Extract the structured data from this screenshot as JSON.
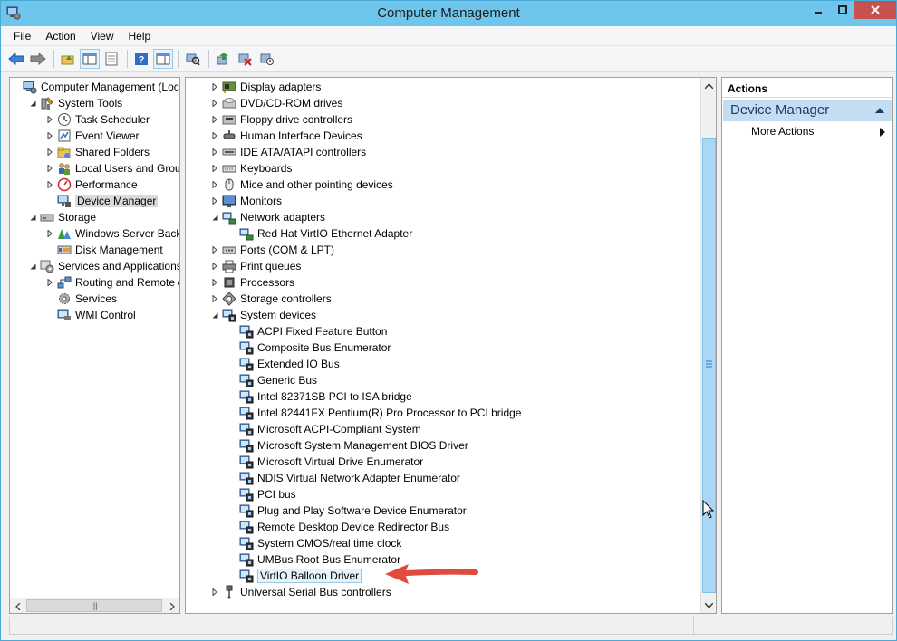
{
  "window": {
    "title": "Computer Management"
  },
  "menu": [
    "File",
    "Action",
    "View",
    "Help"
  ],
  "left_tree": [
    {
      "label": "Computer Management (Local",
      "level": 0,
      "expander": "none",
      "icon": "computer-management-icon"
    },
    {
      "label": "System Tools",
      "level": 1,
      "expander": "expanded",
      "icon": "system-tools-icon"
    },
    {
      "label": "Task Scheduler",
      "level": 2,
      "expander": "collapsed",
      "icon": "clock-icon"
    },
    {
      "label": "Event Viewer",
      "level": 2,
      "expander": "collapsed",
      "icon": "event-viewer-icon"
    },
    {
      "label": "Shared Folders",
      "level": 2,
      "expander": "collapsed",
      "icon": "shared-folder-icon"
    },
    {
      "label": "Local Users and Groups",
      "level": 2,
      "expander": "collapsed",
      "icon": "users-icon"
    },
    {
      "label": "Performance",
      "level": 2,
      "expander": "collapsed",
      "icon": "performance-icon"
    },
    {
      "label": "Device Manager",
      "level": 2,
      "expander": "none",
      "icon": "device-manager-icon",
      "selected": true
    },
    {
      "label": "Storage",
      "level": 1,
      "expander": "expanded",
      "icon": "storage-icon"
    },
    {
      "label": "Windows Server Backup",
      "level": 2,
      "expander": "collapsed",
      "icon": "backup-icon"
    },
    {
      "label": "Disk Management",
      "level": 2,
      "expander": "none",
      "icon": "disk-icon"
    },
    {
      "label": "Services and Applications",
      "level": 1,
      "expander": "expanded",
      "icon": "services-apps-icon"
    },
    {
      "label": "Routing and Remote Ac",
      "level": 2,
      "expander": "collapsed",
      "icon": "routing-icon"
    },
    {
      "label": "Services",
      "level": 2,
      "expander": "none",
      "icon": "services-gear-icon"
    },
    {
      "label": "WMI Control",
      "level": 2,
      "expander": "none",
      "icon": "wmi-icon"
    }
  ],
  "device_tree": [
    {
      "label": "Display adapters",
      "level": 0,
      "expander": "collapsed",
      "icon": "display-adapter-icon"
    },
    {
      "label": "DVD/CD-ROM drives",
      "level": 0,
      "expander": "collapsed",
      "icon": "dvd-drive-icon"
    },
    {
      "label": "Floppy drive controllers",
      "level": 0,
      "expander": "collapsed",
      "icon": "floppy-controller-icon"
    },
    {
      "label": "Human Interface Devices",
      "level": 0,
      "expander": "collapsed",
      "icon": "hid-icon"
    },
    {
      "label": "IDE ATA/ATAPI controllers",
      "level": 0,
      "expander": "collapsed",
      "icon": "ide-controller-icon"
    },
    {
      "label": "Keyboards",
      "level": 0,
      "expander": "collapsed",
      "icon": "keyboard-icon"
    },
    {
      "label": "Mice and other pointing devices",
      "level": 0,
      "expander": "collapsed",
      "icon": "mouse-icon"
    },
    {
      "label": "Monitors",
      "level": 0,
      "expander": "collapsed",
      "icon": "monitor-icon"
    },
    {
      "label": "Network adapters",
      "level": 0,
      "expander": "expanded",
      "icon": "network-adapter-icon"
    },
    {
      "label": "Red Hat VirtIO Ethernet Adapter",
      "level": 1,
      "expander": "none",
      "icon": "network-adapter-icon"
    },
    {
      "label": "Ports (COM & LPT)",
      "level": 0,
      "expander": "collapsed",
      "icon": "port-icon"
    },
    {
      "label": "Print queues",
      "level": 0,
      "expander": "collapsed",
      "icon": "printer-icon"
    },
    {
      "label": "Processors",
      "level": 0,
      "expander": "collapsed",
      "icon": "processor-icon"
    },
    {
      "label": "Storage controllers",
      "level": 0,
      "expander": "collapsed",
      "icon": "storage-controller-icon"
    },
    {
      "label": "System devices",
      "level": 0,
      "expander": "expanded",
      "icon": "system-device-icon"
    },
    {
      "label": "ACPI Fixed Feature Button",
      "level": 1,
      "expander": "none",
      "icon": "system-device-icon"
    },
    {
      "label": "Composite Bus Enumerator",
      "level": 1,
      "expander": "none",
      "icon": "system-device-icon"
    },
    {
      "label": "Extended IO Bus",
      "level": 1,
      "expander": "none",
      "icon": "system-device-icon"
    },
    {
      "label": "Generic Bus",
      "level": 1,
      "expander": "none",
      "icon": "system-device-icon"
    },
    {
      "label": "Intel 82371SB PCI to ISA bridge",
      "level": 1,
      "expander": "none",
      "icon": "system-device-icon"
    },
    {
      "label": "Intel 82441FX Pentium(R) Pro Processor to PCI bridge",
      "level": 1,
      "expander": "none",
      "icon": "system-device-icon"
    },
    {
      "label": "Microsoft ACPI-Compliant System",
      "level": 1,
      "expander": "none",
      "icon": "system-device-icon"
    },
    {
      "label": "Microsoft System Management BIOS Driver",
      "level": 1,
      "expander": "none",
      "icon": "system-device-icon"
    },
    {
      "label": "Microsoft Virtual Drive Enumerator",
      "level": 1,
      "expander": "none",
      "icon": "system-device-icon"
    },
    {
      "label": "NDIS Virtual Network Adapter Enumerator",
      "level": 1,
      "expander": "none",
      "icon": "system-device-icon"
    },
    {
      "label": "PCI bus",
      "level": 1,
      "expander": "none",
      "icon": "system-device-icon"
    },
    {
      "label": "Plug and Play Software Device Enumerator",
      "level": 1,
      "expander": "none",
      "icon": "system-device-icon"
    },
    {
      "label": "Remote Desktop Device Redirector Bus",
      "level": 1,
      "expander": "none",
      "icon": "system-device-icon"
    },
    {
      "label": "System CMOS/real time clock",
      "level": 1,
      "expander": "none",
      "icon": "system-device-icon"
    },
    {
      "label": "UMBus Root Bus Enumerator",
      "level": 1,
      "expander": "none",
      "icon": "system-device-icon"
    },
    {
      "label": "VirtIO Balloon Driver",
      "level": 1,
      "expander": "none",
      "icon": "system-device-icon",
      "selected": true
    },
    {
      "label": "Universal Serial Bus controllers",
      "level": 0,
      "expander": "collapsed",
      "icon": "usb-icon"
    }
  ],
  "actions": {
    "header": "Actions",
    "section": "Device Manager",
    "more": "More Actions"
  },
  "colors": {
    "titlebar": "#6ec6ec",
    "close_button": "#c75050",
    "annotation_arrow": "#e04a3f",
    "actions_section_bg": "#c5ddf3"
  }
}
